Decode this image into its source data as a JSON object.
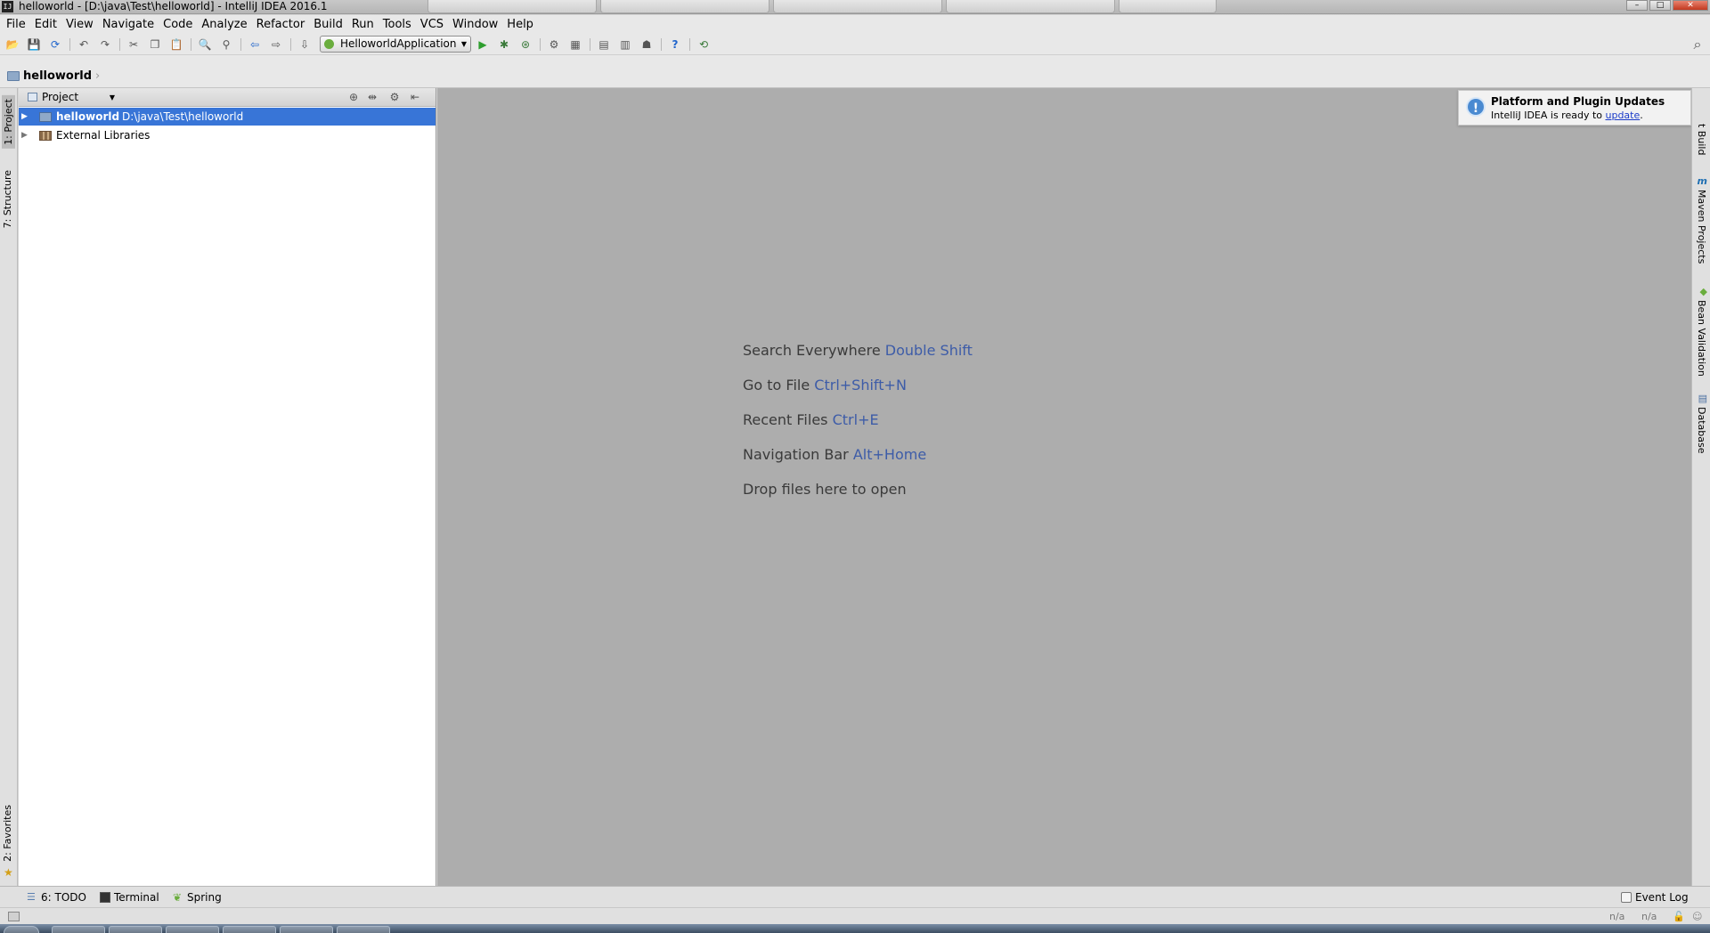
{
  "window": {
    "title": "helloworld - [D:\\java\\Test\\helloworld] - IntelliJ IDEA 2016.1",
    "app_icon": "IJ",
    "controls": [
      "–",
      "□",
      "✕"
    ]
  },
  "menu": {
    "items": [
      "File",
      "Edit",
      "View",
      "Navigate",
      "Code",
      "Analyze",
      "Refactor",
      "Build",
      "Run",
      "Tools",
      "VCS",
      "Window",
      "Help"
    ]
  },
  "toolbar": {
    "run_config": "HelloworldApplication",
    "icons": [
      "open-folder-icon",
      "save-icon",
      "sync-icon",
      "undo-icon",
      "redo-icon",
      "cut-icon",
      "copy-icon",
      "paste-icon",
      "find-icon",
      "replace-icon",
      "back-icon",
      "forward-icon",
      "make-icon",
      "run-icon",
      "debug-icon",
      "coverage-icon",
      "settings-icon",
      "project-structure-icon",
      "sdk-icon",
      "avd-icon",
      "android-icon",
      "help-icon",
      "vcs-icon",
      "search-icon"
    ],
    "glyphs": {
      "open": "📂",
      "save": "💾",
      "sync": "⟳",
      "undo": "↶",
      "redo": "↷",
      "cut": "✂",
      "copy": "❐",
      "paste": "📋",
      "find": "🔍",
      "replace": "⚲",
      "back": "⇦",
      "forward": "⇨",
      "make": "⇩",
      "run": "▶",
      "debug": "✱",
      "coverage": "⊛",
      "settings": "⚙",
      "structure": "▦",
      "sdk": "▤",
      "avd": "▥",
      "android": "☗",
      "help": "?",
      "vcs": "⟲",
      "search": "⌕"
    },
    "colors": {
      "run": "#2e9e2e",
      "help": "#2266cc"
    }
  },
  "navbar": {
    "breadcrumb": "helloworld"
  },
  "left_tabs": {
    "project": "1: Project",
    "structure": "7: Structure",
    "favorites": "2: Favorites"
  },
  "right_tabs": {
    "ant_build": "t Build",
    "maven": "Maven Projects",
    "bean_validation": "Bean Validation",
    "database": "Database",
    "maven_icon": "m"
  },
  "project_panel": {
    "view": "Project",
    "header_icons": [
      "⊕",
      "⇹",
      "⚙",
      "⇤"
    ],
    "tree": [
      {
        "name": "helloworld",
        "path": "D:\\java\\Test\\helloworld",
        "selected": true
      },
      {
        "name": "External Libraries",
        "path": "",
        "selected": false
      }
    ]
  },
  "editor": {
    "hints": [
      {
        "text": "Search Everywhere",
        "key": "Double Shift"
      },
      {
        "text": "Go to File",
        "key": "Ctrl+Shift+N"
      },
      {
        "text": "Recent Files",
        "key": "Ctrl+E"
      },
      {
        "text": "Navigation Bar",
        "key": "Alt+Home"
      },
      {
        "text": "Drop files here to open",
        "key": ""
      }
    ],
    "background": "#adadad",
    "key_color": "#3d5ca8"
  },
  "notification": {
    "title": "Platform and Plugin Updates",
    "body": "IntelliJ IDEA is ready to",
    "link": "update",
    "suffix": ".",
    "icon": "!"
  },
  "bottom": {
    "todo": "6: TODO",
    "terminal": "Terminal",
    "spring": "Spring",
    "event_log": "Event Log"
  },
  "status": {
    "pos1": "n/a",
    "pos2": "n/a"
  },
  "colors": {
    "selection": "#3875d7",
    "panel_bg": "#ffffff",
    "chrome_bg": "#e8e8e8"
  }
}
